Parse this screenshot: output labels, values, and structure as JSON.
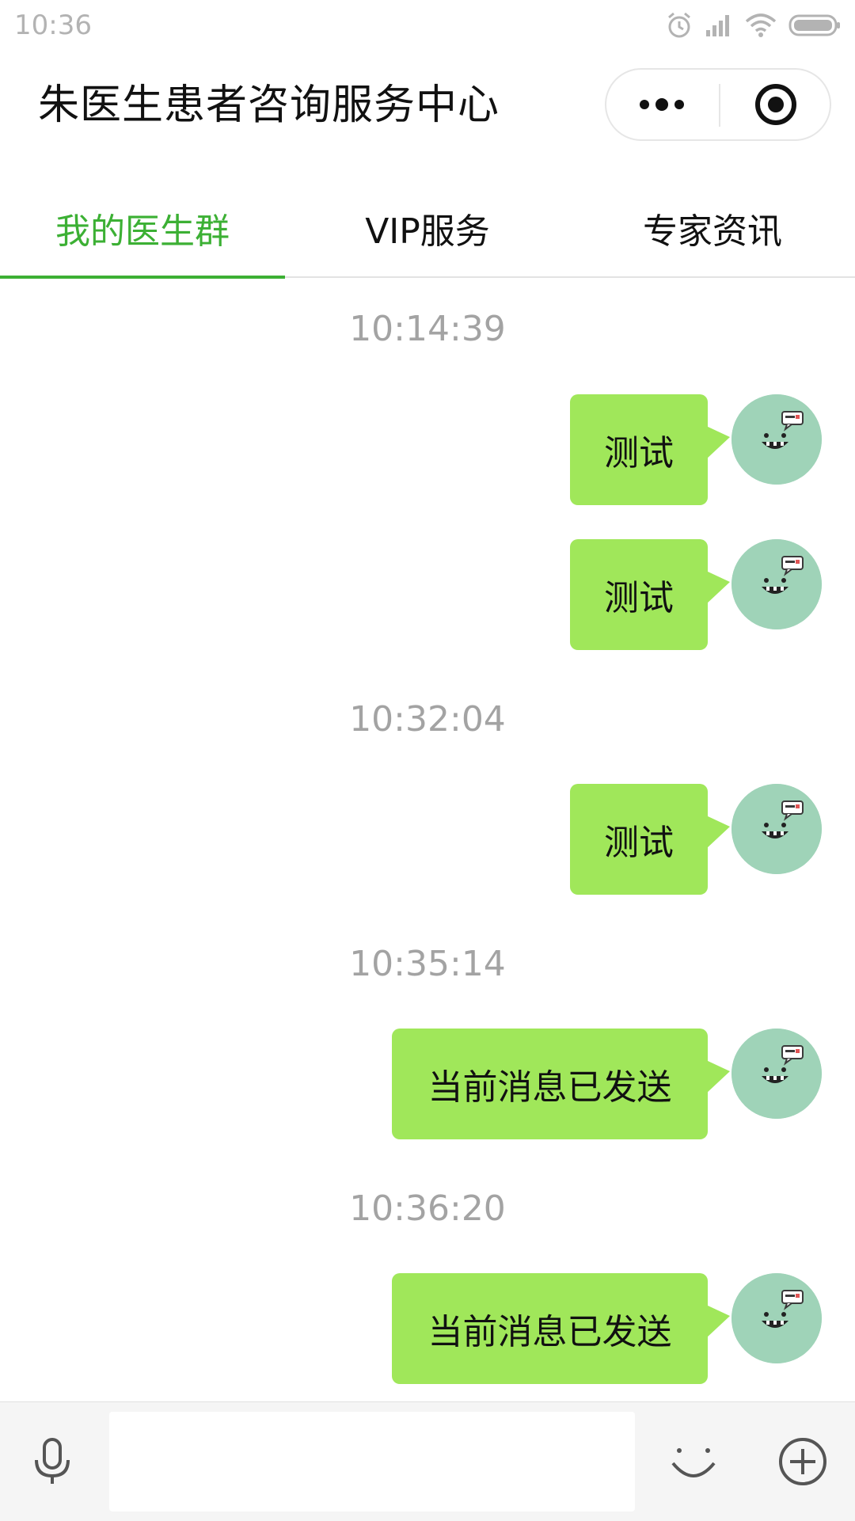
{
  "status_bar": {
    "time": "10:36",
    "icons": [
      "alarm-icon",
      "signal-icon",
      "wifi-icon",
      "battery-icon"
    ]
  },
  "header": {
    "title": "朱医生患者咨询服务中心",
    "capsule_icons": [
      "more-icon",
      "record-icon"
    ]
  },
  "tabs": [
    {
      "label": "我的医生群",
      "active": true
    },
    {
      "label": "VIP服务",
      "active": false
    },
    {
      "label": "专家资讯",
      "active": false
    }
  ],
  "messages": [
    {
      "type": "time",
      "text": "10:14:39"
    },
    {
      "type": "msg",
      "text": "测试"
    },
    {
      "type": "msg",
      "text": "测试"
    },
    {
      "type": "time",
      "text": "10:32:04"
    },
    {
      "type": "msg",
      "text": "测试"
    },
    {
      "type": "time",
      "text": "10:35:14"
    },
    {
      "type": "msg",
      "text": "当前消息已发送"
    },
    {
      "type": "time",
      "text": "10:36:20"
    },
    {
      "type": "msg",
      "text": "当前消息已发送"
    }
  ],
  "input_bar": {
    "value": "",
    "icons": [
      "microphone-icon",
      "emoji-icon",
      "add-icon"
    ]
  },
  "colors": {
    "accent": "#3cb034",
    "bubble": "#a0e75a",
    "avatar_bg": "#9fd3b8"
  }
}
